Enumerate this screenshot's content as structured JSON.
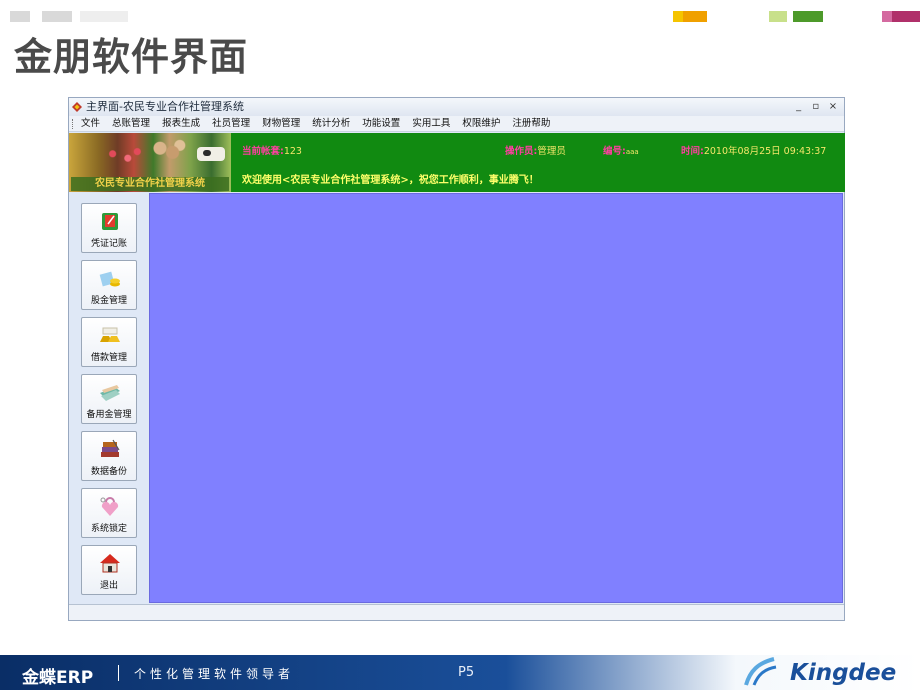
{
  "slide": {
    "title": "金朋软件界面"
  },
  "window": {
    "title": "主界面-农民专业合作社管理系统",
    "controls": {
      "minimize": "_",
      "restore": "▫",
      "close": "×"
    }
  },
  "menu": {
    "items": [
      "文件",
      "总账管理",
      "报表生成",
      "社员管理",
      "财物管理",
      "统计分析",
      "功能设置",
      "实用工具",
      "权限维护",
      "注册帮助"
    ]
  },
  "banner": {
    "image_caption": "农民专业合作社管理系统",
    "account_label": "当前帐套:",
    "account_value": "123",
    "operator_label": "操作员:",
    "operator_value": "管理员",
    "code_label": "编号:",
    "code_value": "aaa",
    "time_label": "时间:",
    "time_value": "2010年08月25日 09:43:37",
    "welcome": "欢迎使用<农民专业合作社管理系统>，祝您工作顺利，事业腾飞！"
  },
  "sidebar": {
    "items": [
      {
        "label": "凭证记账",
        "icon": "voucher-book-icon"
      },
      {
        "label": "股金管理",
        "icon": "shares-calculator-icon"
      },
      {
        "label": "借款管理",
        "icon": "gold-bars-icon"
      },
      {
        "label": "备用金管理",
        "icon": "banknotes-icon"
      },
      {
        "label": "数据备份",
        "icon": "stacked-books-icon"
      },
      {
        "label": "系统锁定",
        "icon": "padlock-keys-icon"
      },
      {
        "label": "退出",
        "icon": "house-exit-icon"
      }
    ]
  },
  "colors": {
    "banner_green": "#118a11",
    "workspace_blue": "#8080ff",
    "label_pink": "#ff3ea0",
    "value_yellow": "#f5e76a",
    "footer_navy": "#0a2e66"
  },
  "footer": {
    "brand": "金蝶ERP",
    "slogan": "个性化管理软件领导者",
    "page": "P5",
    "company": "Kingdee"
  }
}
